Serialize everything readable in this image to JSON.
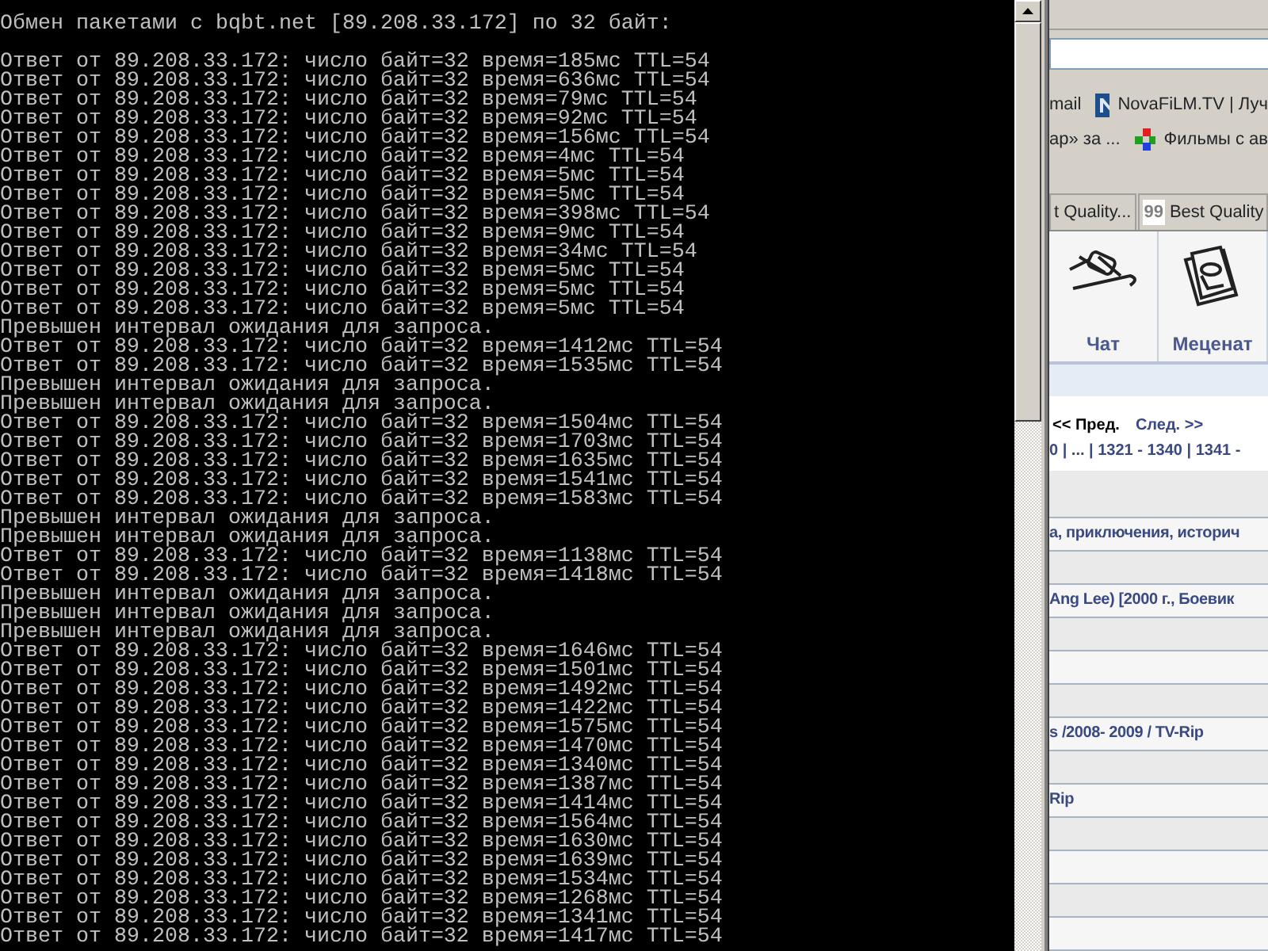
{
  "console": {
    "header": "Обмен пакетами с bqbt.net [89.208.33.172] по 32 байт:",
    "lines": [
      "Ответ от 89.208.33.172: число байт=32 время=185мс TTL=54",
      "Ответ от 89.208.33.172: число байт=32 время=636мс TTL=54",
      "Ответ от 89.208.33.172: число байт=32 время=79мс TTL=54",
      "Ответ от 89.208.33.172: число байт=32 время=92мс TTL=54",
      "Ответ от 89.208.33.172: число байт=32 время=156мс TTL=54",
      "Ответ от 89.208.33.172: число байт=32 время=4мс TTL=54",
      "Ответ от 89.208.33.172: число байт=32 время=5мс TTL=54",
      "Ответ от 89.208.33.172: число байт=32 время=5мс TTL=54",
      "Ответ от 89.208.33.172: число байт=32 время=398мс TTL=54",
      "Ответ от 89.208.33.172: число байт=32 время=9мс TTL=54",
      "Ответ от 89.208.33.172: число байт=32 время=34мс TTL=54",
      "Ответ от 89.208.33.172: число байт=32 время=5мс TTL=54",
      "Ответ от 89.208.33.172: число байт=32 время=5мс TTL=54",
      "Ответ от 89.208.33.172: число байт=32 время=5мс TTL=54",
      "Превышен интервал ожидания для запроса.",
      "Ответ от 89.208.33.172: число байт=32 время=1412мс TTL=54",
      "Ответ от 89.208.33.172: число байт=32 время=1535мс TTL=54",
      "Превышен интервал ожидания для запроса.",
      "Превышен интервал ожидания для запроса.",
      "Ответ от 89.208.33.172: число байт=32 время=1504мс TTL=54",
      "Ответ от 89.208.33.172: число байт=32 время=1703мс TTL=54",
      "Ответ от 89.208.33.172: число байт=32 время=1635мс TTL=54",
      "Ответ от 89.208.33.172: число байт=32 время=1541мс TTL=54",
      "Ответ от 89.208.33.172: число байт=32 время=1583мс TTL=54",
      "Превышен интервал ожидания для запроса.",
      "Превышен интервал ожидания для запроса.",
      "Ответ от 89.208.33.172: число байт=32 время=1138мс TTL=54",
      "Ответ от 89.208.33.172: число байт=32 время=1418мс TTL=54",
      "Превышен интервал ожидания для запроса.",
      "Превышен интервал ожидания для запроса.",
      "Превышен интервал ожидания для запроса.",
      "Ответ от 89.208.33.172: число байт=32 время=1646мс TTL=54",
      "Ответ от 89.208.33.172: число байт=32 время=1501мс TTL=54",
      "Ответ от 89.208.33.172: число байт=32 время=1492мс TTL=54",
      "Ответ от 89.208.33.172: число байт=32 время=1422мс TTL=54",
      "Ответ от 89.208.33.172: число байт=32 время=1575мс TTL=54",
      "Ответ от 89.208.33.172: число байт=32 время=1470мс TTL=54",
      "Ответ от 89.208.33.172: число байт=32 время=1340мс TTL=54",
      "Ответ от 89.208.33.172: число байт=32 время=1387мс TTL=54",
      "Ответ от 89.208.33.172: число байт=32 время=1414мс TTL=54",
      "Ответ от 89.208.33.172: число байт=32 время=1564мс TTL=54",
      "Ответ от 89.208.33.172: число байт=32 время=1630мс TTL=54",
      "Ответ от 89.208.33.172: число байт=32 время=1639мс TTL=54",
      "Ответ от 89.208.33.172: число байт=32 время=1534мс TTL=54",
      "Ответ от 89.208.33.172: число байт=32 время=1268мс TTL=54",
      "Ответ от 89.208.33.172: число байт=32 время=1341мс TTL=54",
      "Ответ от 89.208.33.172: число байт=32 время=1417мс TTL=54"
    ]
  },
  "browser": {
    "bookmark_rows": [
      [
        {
          "kind": "text",
          "label": "mail"
        },
        {
          "kind": "logo",
          "label": "NovaFiLM.TV | Луч"
        }
      ],
      [
        {
          "kind": "text",
          "label": "ар» за ..."
        },
        {
          "kind": "colors",
          "label": "Фильмы с ав"
        }
      ]
    ],
    "tabs": [
      {
        "label": "t Quality...",
        "selected": false
      },
      {
        "label": "Best Quality",
        "icon_text": "99",
        "selected": false
      }
    ],
    "nav": [
      {
        "kind": "cable",
        "label": "Чат"
      },
      {
        "kind": "papers",
        "label": "Меценат"
      }
    ],
    "pager": {
      "prev": "<< Пред.",
      "next": "След. >>",
      "pages": "0 | ... | 1321 - 1340 | 1341 -"
    },
    "rows": [
      {},
      {
        "title": "а, приключения, историч"
      },
      {},
      {
        "title": "Ang Lee) [2000 г., Боевик"
      },
      {},
      {},
      {},
      {
        "title": "s /2008- 2009 / TV-Rip"
      },
      {},
      {
        "title": "Rip"
      },
      {},
      {},
      {},
      {}
    ]
  }
}
